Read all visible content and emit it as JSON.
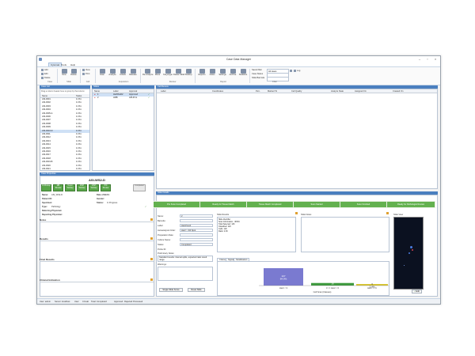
{
  "window": {
    "title": "Case Data Manager"
  },
  "menu": {
    "items": [
      "Cytomat",
      "Tools",
      "Help"
    ]
  },
  "ribbon": {
    "buttons": {
      "add": "Add",
      "delete": "Delete",
      "new": "New",
      "view": "View",
      "print": "Print",
      "scan": "Scan",
      "analyze": "Analyze",
      "unlock": "Unlock",
      "release": "Release",
      "reanalyze": "Re-Analyze",
      "move": "Move",
      "karyotype": "Karyotype",
      "deleteslide": "Delete Slide",
      "reports": "Reports",
      "workup": "Workup",
      "notes": "Notes",
      "statistics": "Statistics",
      "settings": "Settings",
      "archive": "Archive",
      "log": "Log"
    },
    "small": {
      "edit": "Edit",
      "delete_small": "Delete"
    },
    "groups": {
      "case": "Case",
      "slide": "Slide",
      "cell": "Cell",
      "acquisition": "Acquisition",
      "review": "Review",
      "report": "Report",
      "filter": "Filter"
    },
    "fields": {
      "saved_filter_label": "Saved filter",
      "saved_filter_value": "All cases",
      "case_status_label": "Case Status",
      "slide_barcode_label": "Slide Barcode"
    }
  },
  "case_list": {
    "header": "Case List",
    "group_hint": "Drag a column header here to group by that column",
    "columns": [
      "Name",
      "Status"
    ],
    "rows": [
      {
        "name": "ASI-0001",
        "status": "In Pro"
      },
      {
        "name": "ASI-0002",
        "status": "In Pro"
      },
      {
        "name": "ASI-0003",
        "status": "In Pro"
      },
      {
        "name": "ASI-0004",
        "status": "In Pro"
      },
      {
        "name": "ASI-0005-A",
        "status": "In Pro"
      },
      {
        "name": "ASI-0006",
        "status": "In Pro"
      },
      {
        "name": "ASI-0007",
        "status": "In Pro"
      },
      {
        "name": "ASI-0008",
        "status": "In Pro"
      },
      {
        "name": "ASI-0009",
        "status": "In Pro"
      },
      {
        "name": "ASI-0010-D",
        "status": "In Pro"
      },
      {
        "name": "ASI-0011",
        "status": "In Pro"
      },
      {
        "name": "ASI-0012",
        "status": "In Pro"
      },
      {
        "name": "ASI-0013",
        "status": "In Pro"
      },
      {
        "name": "ASI-0014",
        "status": "In Pro"
      },
      {
        "name": "ASI-0015",
        "status": "In Pro"
      },
      {
        "name": "ASI-0016",
        "status": "In Pro"
      },
      {
        "name": "ASI-0017",
        "status": "In Pro"
      },
      {
        "name": "ASI-0018",
        "status": "In Pro"
      },
      {
        "name": "ASI-0019-B",
        "status": "In Pro"
      },
      {
        "name": "ASI-0020",
        "status": "In Pro"
      },
      {
        "name": "ASI-0021",
        "status": "In Pro"
      }
    ]
  },
  "slides": {
    "header": "Slides",
    "columns": [
      "Name",
      "Label",
      "Approval"
    ],
    "rows": [
      {
        "name": "1",
        "label": "HerDbst02",
        "approval": "Approved"
      },
      {
        "name": "2",
        "label": "HRB",
        "approval": "APLIP-lo"
      }
    ]
  },
  "cell_review": {
    "header": "Cell Review",
    "columns": [
      "Label",
      "Coordinates",
      "Peri..",
      "Marked To",
      "Cell Quality",
      "Analyze State",
      "Assigned On",
      "Created On"
    ]
  },
  "case_details": {
    "header": "Case Properties",
    "case_id": "ASI-WS2-D",
    "buttons": [
      "IN Workup",
      "MR Review",
      "Tumor Workup",
      "FISH Workup",
      "CISH Workup",
      "IHC Review",
      "Completed"
    ],
    "fields": {
      "name_label": "Name:",
      "name_value": "ASI_WS2-D",
      "dob_label": "Date of Birth:",
      "dob_value": "",
      "patient_label": "Patient ID:",
      "patient_value": "",
      "gender_label": "Gender:",
      "gender_value": "",
      "specimen_label": "Specimen:",
      "specimen_value": "",
      "status_label": "Status:",
      "status_value": "In Progress",
      "type_label": "Type:",
      "type_value": "Pathology",
      "referring_label": "Referring Physician:",
      "reporting_label": "Reporting Physician:"
    },
    "sections": [
      "Notes",
      "Results",
      "Final Results",
      "Clinical Indication"
    ]
  },
  "slide_details": {
    "header": "Slide Details",
    "stages": [
      "Pre Scan Completed",
      "Ready for Tissue Match",
      "Tissue Match Completed",
      "Scan Started",
      "Scan Finished",
      "Ready for Pathologist Review"
    ],
    "fields": {
      "name_label": "Name:",
      "name_value": "2",
      "barcode_label": "Barcode:",
      "barcode_value": "",
      "label_label": "Label:",
      "label_value": "Her2/neu2",
      "autoanalysis_label": "Autoanalysis Order:",
      "autoanalysis_value": "Her2 > 3/4 Spot",
      "prep_label": "Preparation Date:",
      "prep_value": "",
      "culture_label": "Culture Name:",
      "culture_value": "",
      "status_label": "Status:",
      "status_value": "Completed",
      "probe_label": "Probe ID:",
      "probe_value": "",
      "prelim_label": "Preliminary Notes:",
      "prelim_value": "Standard results: interval splits, expected ratio result range",
      "warnings_label": "Warnings:"
    },
    "slide_results_title": "Slide Results",
    "slide_results": [
      "Slide Identifier",
      "Scan Information - 38 BU",
      "Total Selected: 126",
      "Classified: 120",
      "Cells: 120",
      "Ratio: 2.39"
    ],
    "slide_notes_title": "Slide Notes",
    "slide_view_title": "Slide View",
    "tabs": [
      "Classes",
      "Signals",
      "Stratification"
    ],
    "buttons": {
      "single_slide_score": "Single Slide Score",
      "reset_slide": "Reset Slide",
      "edit": "Edit"
    }
  },
  "chart_data": {
    "type": "bar",
    "xlabel": "Cell Scan (Classes)",
    "categories": [
      "Her2 < 3",
      "3 <= Her2 < 6",
      "Her2 >= 6"
    ],
    "values": [
      107,
      16,
      3
    ],
    "labels": [
      "107\n84.9%",
      "16\n12.7%",
      "3\n2.4%"
    ],
    "colors": [
      "#7a7ad0",
      "#3d9a3d",
      "#d8c530"
    ]
  },
  "status_bar": {
    "items": [
      "User: admin",
      "Server: localhost",
      "User: ",
      "CCLab",
      "Total: Completed: ",
      "Approved: ",
      "Rejected Processed"
    ]
  }
}
